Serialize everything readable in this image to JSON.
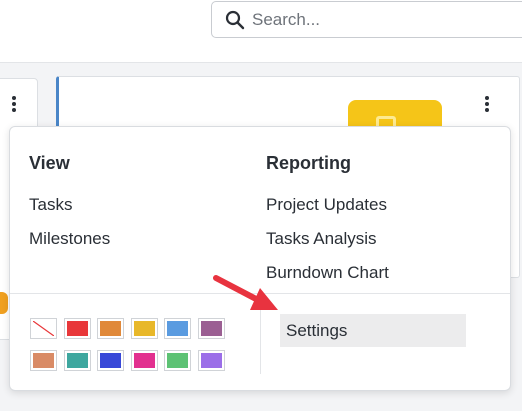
{
  "search": {
    "placeholder": "Search..."
  },
  "menu": {
    "view": {
      "heading": "View",
      "items": [
        "Tasks",
        "Milestones"
      ]
    },
    "reporting": {
      "heading": "Reporting",
      "items": [
        "Project Updates",
        "Tasks Analysis",
        "Burndown Chart"
      ]
    },
    "settings_label": "Settings",
    "color_swatches": [
      [
        "none",
        "#e8373a",
        "#e0893a",
        "#e8b82a",
        "#5a9be0",
        "#9b5f93"
      ],
      [
        "#d98b66",
        "#3ea79f",
        "#3848d8",
        "#e2308f",
        "#5dc274",
        "#9b6ee8"
      ]
    ]
  },
  "colors": {
    "accent_arrow": "#e8333f",
    "card_accent": "#4a86c8",
    "card_logo": "#f5c518"
  }
}
